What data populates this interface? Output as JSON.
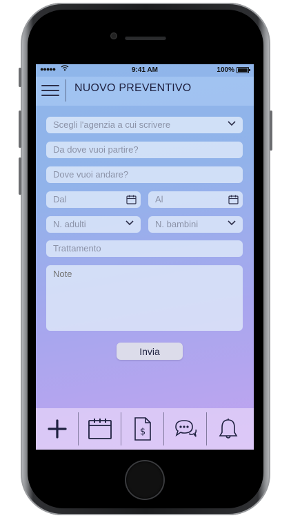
{
  "status_bar": {
    "signal": "●●●●●",
    "wifi": "⌔",
    "time": "9:41 AM",
    "battery": "100%"
  },
  "header": {
    "menu_icon": "hamburger-icon",
    "title": "NUOVO PREVENTIVO"
  },
  "form": {
    "agency": {
      "placeholder": "Scegli l'agenzia a cui scrivere",
      "icon": "chevron-down-icon"
    },
    "from": {
      "placeholder": "Da dove vuoi partire?"
    },
    "to": {
      "placeholder": "Dove vuoi andare?"
    },
    "date_from": {
      "placeholder": "Dal",
      "icon": "calendar-icon"
    },
    "date_to": {
      "placeholder": "Al",
      "icon": "calendar-icon"
    },
    "adults": {
      "placeholder": "N. adulti",
      "icon": "chevron-down-icon"
    },
    "children": {
      "placeholder": "N. bambini",
      "icon": "chevron-down-icon"
    },
    "treatment": {
      "placeholder": "Trattamento"
    },
    "notes": {
      "placeholder": "Note"
    },
    "submit_label": "Invia"
  },
  "tabbar": {
    "items": [
      {
        "icon": "plus-icon"
      },
      {
        "icon": "calendar-icon"
      },
      {
        "icon": "invoice-icon"
      },
      {
        "icon": "chat-icon"
      },
      {
        "icon": "bell-icon"
      }
    ]
  },
  "colors": {
    "screen_top": "#8fb6ea",
    "screen_bottom": "#c2a4f0",
    "text_dark": "#1f2140",
    "placeholder": "#8c93a8"
  }
}
